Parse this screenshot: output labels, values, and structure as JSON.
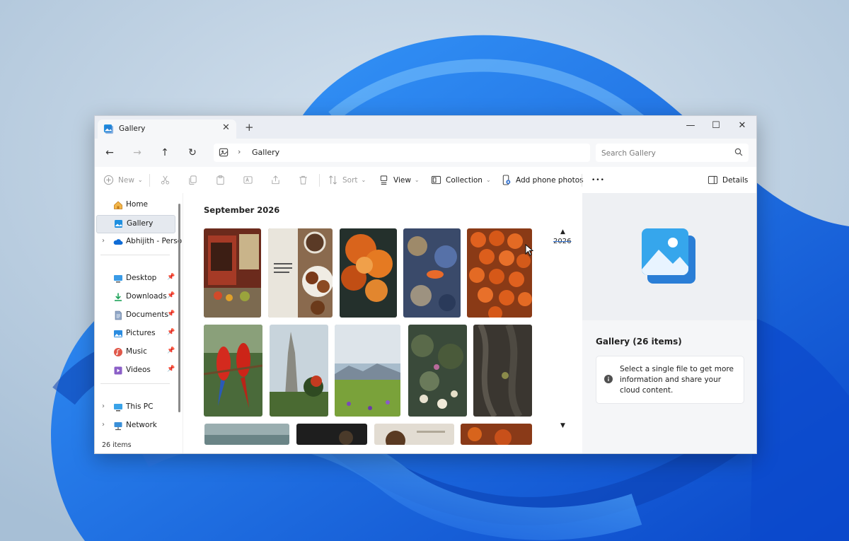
{
  "window": {
    "tab_title": "Gallery",
    "close_glyph": "✕",
    "new_tab_glyph": "+",
    "minimize_glyph": "—",
    "maximize_glyph": "☐",
    "window_close_glyph": "✕"
  },
  "address": {
    "back_glyph": "←",
    "forward_glyph": "→",
    "up_glyph": "↑",
    "refresh_glyph": "↻",
    "breadcrumb": "Gallery",
    "chevron": "›",
    "search_placeholder": "Search Gallery"
  },
  "commands": {
    "new_label": "New",
    "sort_label": "Sort",
    "view_label": "View",
    "collection_label": "Collection",
    "add_phone_label": "Add phone photos",
    "more_label": "•••",
    "details_label": "Details",
    "dropdown_glyph": "⌄"
  },
  "nav": {
    "home": "Home",
    "gallery": "Gallery",
    "onedrive": "Abhijith - Personal",
    "desktop": "Desktop",
    "downloads": "Downloads",
    "documents": "Documents",
    "pictures": "Pictures",
    "music": "Music",
    "videos": "Videos",
    "thispc": "This PC",
    "network": "Network",
    "chevron": "›",
    "pin": "📌"
  },
  "status": {
    "item_count": "26 items"
  },
  "gallery": {
    "group_title": "September 2026",
    "timeline_year": "2026",
    "up_glyph": "▲",
    "down_glyph": "▼"
  },
  "details": {
    "title": "Gallery (26 items)",
    "info_text": "Select a single file to get more information and share your cloud content."
  },
  "icons": {
    "gallery": "gallery-icon",
    "home": "home-icon",
    "onedrive": "cloud-icon",
    "desktop": "desktop-icon",
    "downloads": "download-icon",
    "documents": "document-icon",
    "pictures": "picture-icon",
    "music": "music-icon",
    "videos": "video-icon",
    "thispc": "computer-icon",
    "network": "network-icon"
  },
  "colors": {
    "accent": "#2f6fce",
    "wallpaper_blue": "#1565e0"
  }
}
